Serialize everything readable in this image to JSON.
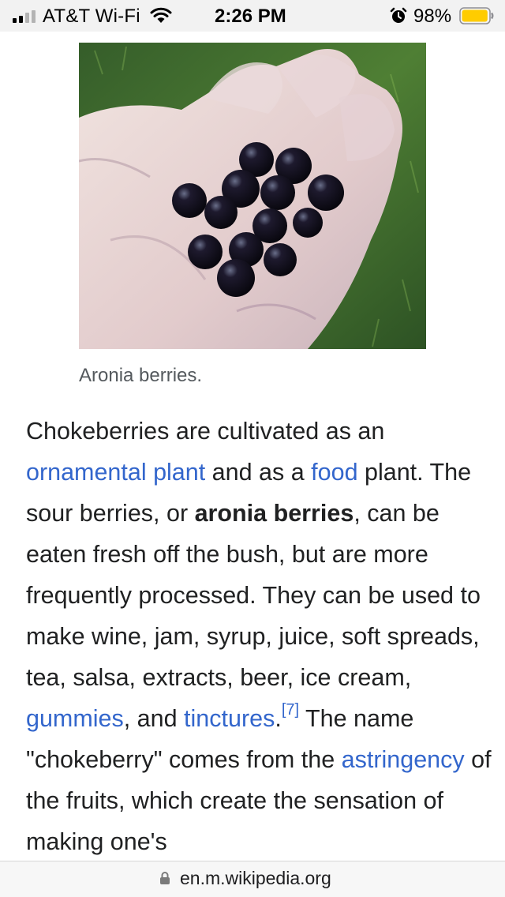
{
  "status_bar": {
    "carrier": "AT&T Wi-Fi",
    "time": "2:26 PM",
    "battery_percent": "98%",
    "battery_level": 0.98,
    "battery_color": "#ffcc00",
    "icons": [
      "signal-icon",
      "wifi-icon",
      "alarm-icon",
      "battery-icon"
    ]
  },
  "figure": {
    "image_subject": "hand-holding-aronia-berries",
    "caption": "Aronia berries."
  },
  "article": {
    "p1": "Chokeberries are cultivated as an ",
    "link_ornamental": "ornamental plant",
    "p2": " and as a ",
    "link_food": "food",
    "p3": " plant. The sour berries, or ",
    "bold_aronia": "aronia berries",
    "p4": ", can be eaten fresh off the bush, but are more frequently processed. They can be used to make wine, jam, syrup, juice, soft spreads, tea, salsa, extracts, beer, ice cream, ",
    "link_gummies": "gummies",
    "p5": ", and ",
    "link_tinctures": "tinctures",
    "p6": ".",
    "ref": "[7]",
    "p7": " The name \"chokeberry\" comes from the ",
    "link_astringency": "astringency",
    "p8": " of the fruits, which create the sensation of making one's",
    "link_color": "#3366cc"
  },
  "url_bar": {
    "url": "en.m.wikipedia.org",
    "icon": "lock-icon"
  }
}
